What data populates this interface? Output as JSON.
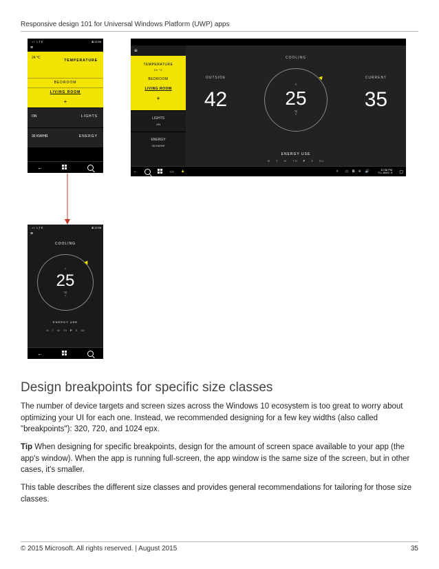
{
  "header": "Responsive design 101 for Universal Windows Platform (UWP) apps",
  "footer": {
    "left": "© 2015 Microsoft. All rights reserved. | August 2015",
    "right": "35"
  },
  "phone1": {
    "status_left": "..ıl  LTE",
    "status_right": "⧈  12:56",
    "temp_reading": "24 °C",
    "temp_label": "TEMPERATURE",
    "room_bedroom": "BEDROOM",
    "room_living": "LIVING ROOM",
    "plus": "+",
    "lights_state": "ON",
    "lights_label": "LIGHTS",
    "energy_value": "35 KW/HR",
    "energy_label": "ENERGY"
  },
  "phone2": {
    "status_left": "..ıl  LTE",
    "status_right": "⧈  12:56",
    "cooling": "COOLING",
    "dial_value": "25",
    "dial_unit": "°C",
    "energy_label": "ENERGY USE",
    "days": [
      "M",
      "T",
      "W",
      "TH",
      "F",
      "S",
      "SU"
    ],
    "day_sel_index": 4
  },
  "tablet": {
    "sidebar": {
      "temp_label": "TEMPERATURE",
      "temp_val": "24 °C",
      "room_bedroom": "BEDROOM",
      "room_living": "LIVING ROOM",
      "plus": "+",
      "lights_label": "LIGHTS",
      "lights_state": "ON",
      "energy_label": "ENERGY",
      "energy_value": "35 KW/HR"
    },
    "main": {
      "outside_label": "OUTSIDE",
      "outside_val": "42",
      "cooling_label": "COOLING",
      "cooling_val": "25",
      "cooling_unit": "°C",
      "current_label": "CURRENT",
      "current_val": "35",
      "energy_label": "ENERGY USE",
      "days": [
        "M",
        "T",
        "W",
        "TH",
        "F",
        "S",
        "SU"
      ],
      "day_sel_index": 4
    },
    "taskbar_time": "12:56 PM",
    "taskbar_date": "7/1..AM/2..5"
  },
  "section_title": "Design breakpoints for specific size classes",
  "para1": "The number of device targets and screen sizes across the Windows 10 ecosystem is too great to worry about optimizing your UI for each one. Instead, we recommended designing for a few key widths (also called \"breakpoints\"): 320, 720, and 1024 epx.",
  "tip_label": "Tip",
  "para2": "  When designing for specific breakpoints, design for the amount of screen space available to your app (the app's window). When the app is running full-screen, the app window is the same size of the screen, but in other cases, it's smaller.",
  "para3": "This table describes the different size classes and provides general recommendations for tailoring for those size classes."
}
